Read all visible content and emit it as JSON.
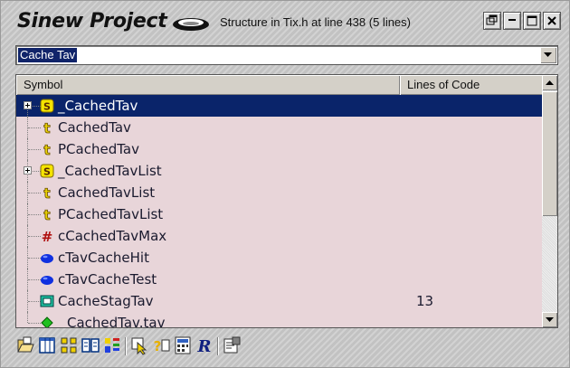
{
  "window": {
    "title": "Sinew Project",
    "subtitle": "Structure in Tix.h at line 438 (5 lines)"
  },
  "search": {
    "value": "Cache Tav"
  },
  "columns": {
    "symbol": "Symbol",
    "loc": "Lines of Code"
  },
  "rows": [
    {
      "name": "_CachedTav",
      "kind": "struct-icon",
      "loc": "",
      "expandable": true,
      "selected": true
    },
    {
      "name": "CachedTav",
      "kind": "typedef-icon",
      "loc": "",
      "expandable": false,
      "selected": false
    },
    {
      "name": "PCachedTav",
      "kind": "typedef-icon",
      "loc": "",
      "expandable": false,
      "selected": false
    },
    {
      "name": "_CachedTavList",
      "kind": "struct-icon",
      "loc": "",
      "expandable": true,
      "selected": false
    },
    {
      "name": "CachedTavList",
      "kind": "typedef-icon",
      "loc": "",
      "expandable": false,
      "selected": false
    },
    {
      "name": "PCachedTavList",
      "kind": "typedef-icon",
      "loc": "",
      "expandable": false,
      "selected": false
    },
    {
      "name": "cCachedTavMax",
      "kind": "define-icon",
      "loc": "",
      "expandable": false,
      "selected": false
    },
    {
      "name": "cTavCacheHit",
      "kind": "enum-member-icon",
      "loc": "",
      "expandable": false,
      "selected": false
    },
    {
      "name": "cTavCacheTest",
      "kind": "enum-member-icon",
      "loc": "",
      "expandable": false,
      "selected": false
    },
    {
      "name": "CacheStagTav",
      "kind": "function-icon",
      "loc": "13",
      "expandable": false,
      "selected": false
    },
    {
      "name": "CachedTav.tav",
      "kind": "member-icon",
      "loc": "",
      "expandable": false,
      "selected": false
    }
  ],
  "toolbar": [
    "open-file-icon",
    "columns-icon",
    "grid-icon",
    "book-icon",
    "color-icon",
    "pointer-icon",
    "help-icon",
    "calculator-icon",
    "refresh-icon",
    "properties-icon"
  ],
  "colors": {
    "selection": "#0a246a",
    "list_background": "#e8d5d9",
    "frame": "#c8c8c8"
  }
}
